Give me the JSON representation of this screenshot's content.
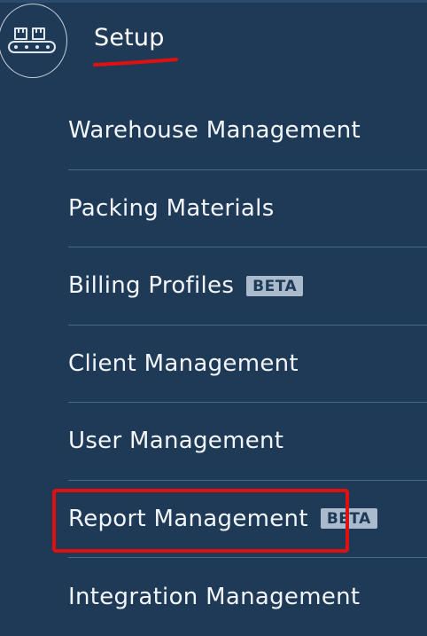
{
  "section": {
    "title": "Setup",
    "icon": "conveyor-icon"
  },
  "menu": {
    "items": [
      {
        "label": "Warehouse Management",
        "badge": ""
      },
      {
        "label": "Packing Materials",
        "badge": ""
      },
      {
        "label": "Billing Profiles",
        "badge": "BETA"
      },
      {
        "label": "Client Management",
        "badge": ""
      },
      {
        "label": "User Management",
        "badge": ""
      },
      {
        "label": "Report Management",
        "badge": "BETA"
      },
      {
        "label": "Integration Management",
        "badge": ""
      }
    ]
  },
  "colors": {
    "background": "#1f3a57",
    "text": "#f2f6fa",
    "badge": "#a9bbcc",
    "divider": "#48698b",
    "annotation": "#e01010"
  }
}
